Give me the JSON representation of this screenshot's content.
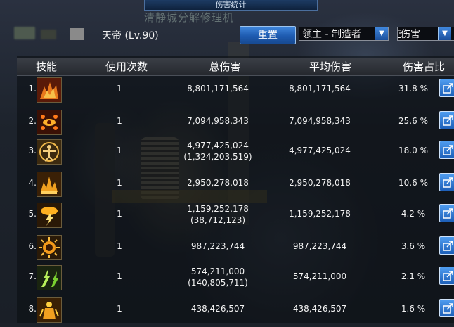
{
  "window": {
    "title": "伤害统计",
    "map_watermark": "清静城分解修理机"
  },
  "player": {
    "label": "天帝 (Lv.90)"
  },
  "controls": {
    "reset_label": "重置",
    "filter_select": "领主 - 制造者",
    "mode_select": "伤害",
    "mode_prefix": "克"
  },
  "table": {
    "headers": [
      "技能",
      "使用次数",
      "总伤害",
      "平均伤害",
      "伤害占比"
    ],
    "rows": [
      {
        "rank": "1.",
        "icon": "flame-beast-skill-icon",
        "count": "1",
        "total": "8,801,171,564",
        "total_sub": "",
        "avg": "8,801,171,564",
        "pct": "31.8 %"
      },
      {
        "rank": "2.",
        "icon": "eye-seal-skill-icon",
        "count": "1",
        "total": "7,094,958,343",
        "total_sub": "",
        "avg": "7,094,958,343",
        "pct": "25.6 %"
      },
      {
        "rank": "3.",
        "icon": "vitruvian-circle-skill-icon",
        "count": "1",
        "total": "4,977,425,024",
        "total_sub": "(1,324,203,519)",
        "avg": "4,977,425,024",
        "pct": "18.0 %"
      },
      {
        "rank": "4.",
        "icon": "crown-spire-skill-icon",
        "count": "1",
        "total": "2,950,278,018",
        "total_sub": "",
        "avg": "2,950,278,018",
        "pct": "10.6 %"
      },
      {
        "rank": "5.",
        "icon": "thunder-cloud-skill-icon",
        "count": "1",
        "total": "1,159,252,178",
        "total_sub": "(38,712,123)",
        "avg": "1,159,252,178",
        "pct": "4.2 %"
      },
      {
        "rank": "6.",
        "icon": "sun-orb-skill-icon",
        "count": "1",
        "total": "987,223,744",
        "total_sub": "",
        "avg": "987,223,744",
        "pct": "3.6 %"
      },
      {
        "rank": "7.",
        "icon": "lightning-burst-skill-icon",
        "count": "1",
        "total": "574,211,000",
        "total_sub": "(140,805,711)",
        "avg": "574,211,000",
        "pct": "2.1 %"
      },
      {
        "rank": "8.",
        "icon": "golden-warrior-skill-icon",
        "count": "1",
        "total": "438,426,507",
        "total_sub": "",
        "avg": "438,426,507",
        "pct": "1.6 %"
      }
    ]
  },
  "colors": {
    "accent_blue": "#1e5bb0",
    "icon_orange": "#e58a1f",
    "text": "#f2f2f2"
  }
}
